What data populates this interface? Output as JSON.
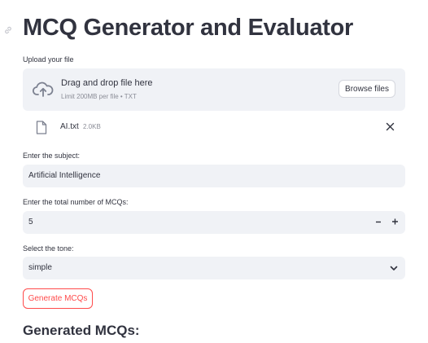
{
  "page": {
    "title": "MCQ Generator and Evaluator",
    "link_icon": "link-icon"
  },
  "uploader": {
    "label": "Upload your file",
    "drop_title": "Drag and drop file here",
    "drop_hint": "Limit 200MB per file • TXT",
    "browse_label": "Browse files",
    "icon": "cloud-upload-icon",
    "file": {
      "name": "AI.txt",
      "size": "2.0KB",
      "icon": "file-icon",
      "close_icon": "close-icon"
    }
  },
  "subject": {
    "label": "Enter the subject:",
    "value": "Artificial Intelligence"
  },
  "mcq_count": {
    "label": "Enter the total number of MCQs:",
    "value": "5",
    "minus": "−",
    "plus": "+"
  },
  "tone": {
    "label": "Select the tone:",
    "value": "simple",
    "icon": "chevron-down-icon"
  },
  "generate_button": "Generate MCQs",
  "results_heading": "Generated MCQs:"
}
